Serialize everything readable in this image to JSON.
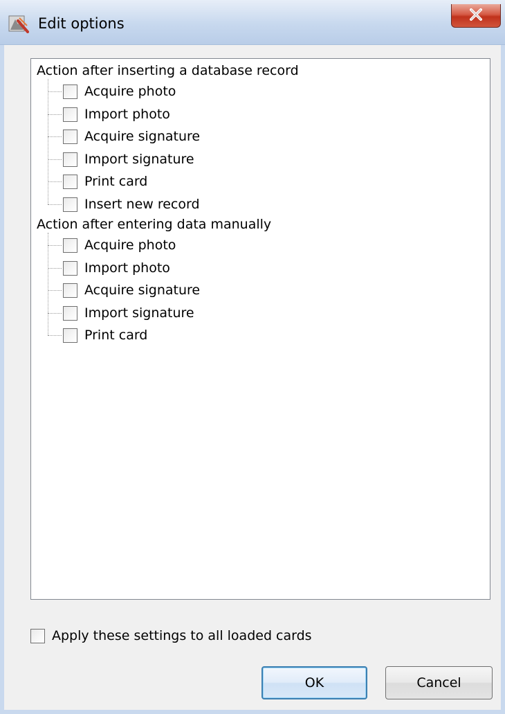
{
  "window": {
    "title": "Edit options"
  },
  "tree": {
    "groups": [
      {
        "label": "Action after inserting a database record",
        "items": [
          {
            "label": "Acquire photo",
            "checked": false
          },
          {
            "label": "Import photo",
            "checked": false
          },
          {
            "label": "Acquire signature",
            "checked": false
          },
          {
            "label": "Import signature",
            "checked": false
          },
          {
            "label": "Print card",
            "checked": false
          },
          {
            "label": "Insert new record",
            "checked": false
          }
        ]
      },
      {
        "label": "Action after entering data manually",
        "items": [
          {
            "label": "Acquire photo",
            "checked": false
          },
          {
            "label": "Import photo",
            "checked": false
          },
          {
            "label": "Acquire signature",
            "checked": false
          },
          {
            "label": "Import signature",
            "checked": false
          },
          {
            "label": "Print card",
            "checked": false
          }
        ]
      }
    ]
  },
  "apply_all": {
    "label": "Apply these settings to all loaded cards",
    "checked": false
  },
  "buttons": {
    "ok": "OK",
    "cancel": "Cancel"
  },
  "icons": {
    "close": "close-icon",
    "app": "app-icon"
  },
  "colors": {
    "close_button": "#c7432c",
    "ok_border": "#3c7fb1",
    "titlebar": "#c7d8ee"
  }
}
